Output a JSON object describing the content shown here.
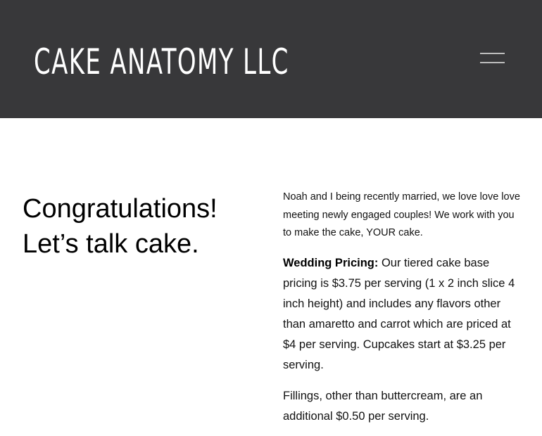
{
  "header": {
    "brand": "CAKE ANATOMY LLC",
    "background_color": "#38383a",
    "menu_icon": "hamburger-menu-icon"
  },
  "main": {
    "heading_line1": "Congratulations!",
    "heading_line2": "Let’s talk cake.",
    "intro": "Noah and I being recently married, we love love love meeting newly engaged couples! We work with you to make the cake, YOUR cake.",
    "wedding_pricing_label": "Wedding Pricing:",
    "wedding_pricing_text": "Our tiered cake base pricing is $3.75 per serving (1 x 2 inch slice 4 inch height) and includes any flavors other than amaretto and carrot which are priced at $4 per serving. Cupcakes start at $3.25 per serving.",
    "fillings_text": "Fillings, other than buttercream, are an additional $0.50 per serving."
  }
}
